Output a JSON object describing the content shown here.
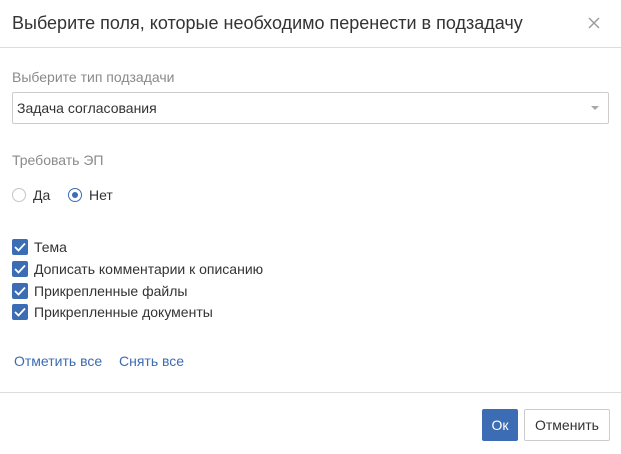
{
  "dialog": {
    "title": "Выберите поля, которые необходимо перенести в подзадачу",
    "close_icon": "close-icon"
  },
  "subtask_type": {
    "label": "Выберите тип подзадачи",
    "value": "Задача согласования",
    "arrow_icon": "chevron-down-icon"
  },
  "signature": {
    "label": "Требовать ЭП",
    "options": [
      {
        "label": "Да",
        "checked": false
      },
      {
        "label": "Нет",
        "checked": true
      }
    ]
  },
  "fields": [
    {
      "label": "Тема",
      "checked": true
    },
    {
      "label": "Дописать комментарии к описанию",
      "checked": true
    },
    {
      "label": "Прикрепленные файлы",
      "checked": true
    },
    {
      "label": "Прикрепленные документы",
      "checked": true
    }
  ],
  "links": {
    "select_all": "Отметить все",
    "clear_all": "Снять все"
  },
  "footer": {
    "ok_label": "Ок",
    "cancel_label": "Отменить"
  },
  "colors": {
    "accent": "#3c6cb3",
    "border": "#cccccc",
    "muted_text": "#8a8a8a"
  }
}
